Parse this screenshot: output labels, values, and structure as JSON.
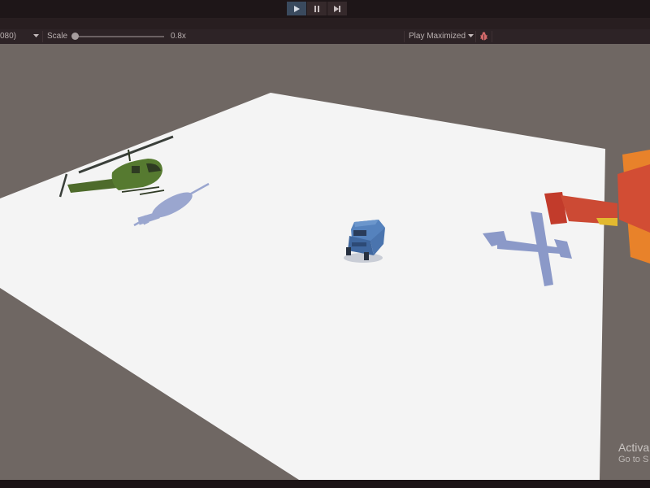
{
  "toolbar": {
    "play_icon": "play-icon",
    "pause_icon": "pause-icon",
    "step_icon": "step-icon",
    "active_color": "#3a4a5e"
  },
  "game_bar": {
    "resolution": "080)",
    "scale_label": "Scale",
    "scale_value": "0.8x",
    "play_maximized": "Play Maximized",
    "stats_icon": "bug-icon"
  },
  "scene": {
    "ground_color": "#f4f4f4",
    "background_color": "#6f6763",
    "objects": [
      "helicopter",
      "jeep",
      "airplane"
    ],
    "helicopter_color": "#4a6a2c",
    "jeep_color": "#4a78b4",
    "airplane_color": "#d04a32",
    "airplane_wing_color": "#e8822a"
  },
  "watermark": {
    "line1": "Activa",
    "line2": "Go to S"
  }
}
